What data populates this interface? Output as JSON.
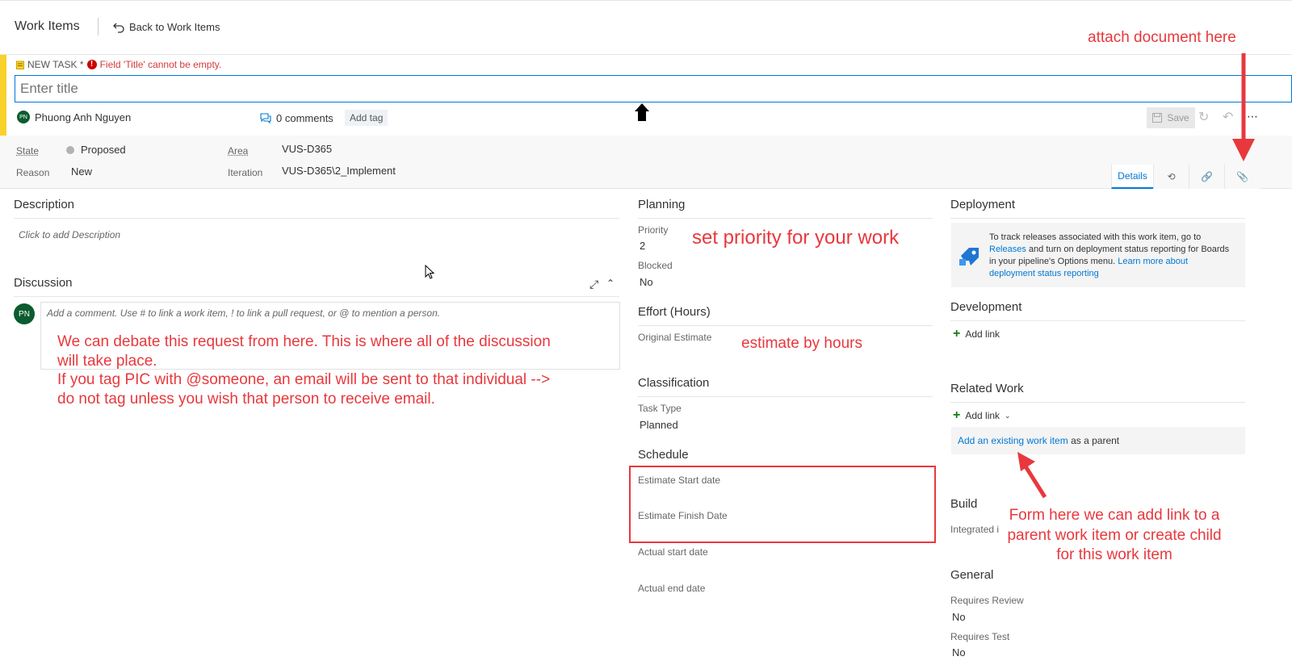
{
  "topbar": {
    "title": "Work Items",
    "back_label": "Back to Work Items"
  },
  "header": {
    "new_task_label": "NEW TASK *",
    "error_text": "Field 'Title' cannot be empty.",
    "title_placeholder": "Enter title",
    "assignee_initials": "PN",
    "assignee_name": "Phuong Anh Nguyen",
    "comments_label": "0 comments",
    "add_tag_label": "Add tag",
    "save_label": "Save"
  },
  "fields": {
    "state_label": "State",
    "state_value": "Proposed",
    "reason_label": "Reason",
    "reason_value": "New",
    "area_label": "Area",
    "area_value": "VUS-D365",
    "iteration_label": "Iteration",
    "iteration_value": "VUS-D365\\2_Implement"
  },
  "tabs": [
    {
      "label": "Details"
    }
  ],
  "description": {
    "title": "Description",
    "placeholder": "Click to add Description"
  },
  "discussion": {
    "title": "Discussion",
    "avatar_initials": "PN",
    "comment_placeholder": "Add a comment. Use # to link a work item, ! to link a pull request, or @ to mention a person."
  },
  "planning": {
    "title": "Planning",
    "priority_label": "Priority",
    "priority_value": "2",
    "blocked_label": "Blocked",
    "blocked_value": "No"
  },
  "effort": {
    "title": "Effort (Hours)",
    "original_estimate_label": "Original Estimate"
  },
  "classification": {
    "title": "Classification",
    "task_type_label": "Task Type",
    "task_type_value": "Planned"
  },
  "schedule": {
    "title": "Schedule",
    "estimate_start_label": "Estimate Start date",
    "estimate_finish_label": "Estimate Finish Date",
    "actual_start_label": "Actual start date",
    "actual_end_label": "Actual end date"
  },
  "deployment": {
    "title": "Deployment",
    "text_1": "To track releases associated with this work item, go to",
    "releases_link": "Releases",
    "text_2": "and turn on deployment status reporting for Boards",
    "text_3": "in your pipeline's Options menu.",
    "learn_more_1": "Learn more about",
    "learn_more_2": "deployment status reporting"
  },
  "development": {
    "title": "Development",
    "add_link_label": "Add link"
  },
  "related_work": {
    "title": "Related Work",
    "add_link_label": "Add link",
    "existing_link": "Add an existing work item",
    "existing_suffix": "as a parent"
  },
  "build": {
    "title": "Build",
    "integrated_label": "Integrated i"
  },
  "general": {
    "title": "General",
    "requires_review_label": "Requires Review",
    "requires_review_value": "No",
    "requires_test_label": "Requires Test",
    "requires_test_value": "No"
  },
  "annotations": {
    "attach": "attach document here",
    "priority": "set priority for your work",
    "estimate": "estimate by hours",
    "discussion_1": "We can debate this request from here. This is where all of the discussion",
    "discussion_2": "will take place.",
    "discussion_3": "If you tag PIC with @someone, an email will be sent to that individual -->",
    "discussion_4": "do not tag unless you wish that person to receive email.",
    "form_1": "Form here we can add link to a",
    "form_2": "parent work item or create child",
    "form_3": "for this work item"
  },
  "colors": {
    "accent": "#0078d4",
    "task_stripe": "#f8d22a",
    "annotation_red": "#e8383d",
    "avatar_green": "#0b5c2e"
  }
}
